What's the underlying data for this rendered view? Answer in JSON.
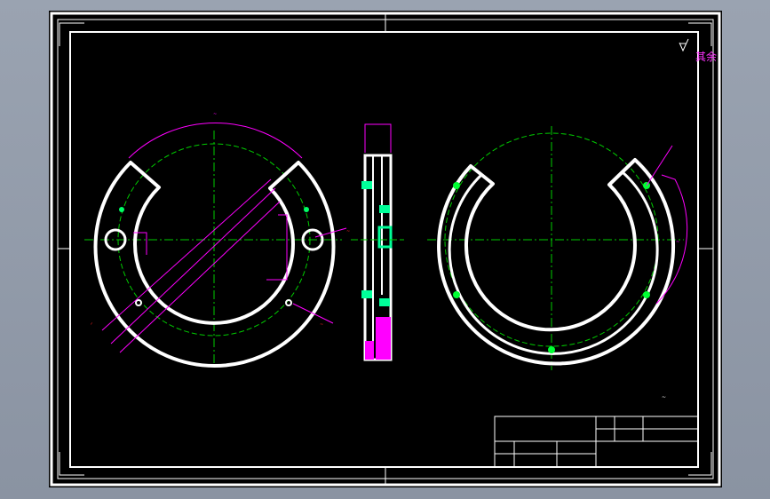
{
  "canvas": {
    "background": "#000000",
    "frame_color": "#ffffff",
    "centerline_color": "#00cc00",
    "dimension_color": "#ff00ff",
    "annotation_color": "#ff2222",
    "highlight_color": "#00ff66",
    "hatch_color": "#ff00ff"
  },
  "note": {
    "text": "其余",
    "surface_symbol": "roughness-symbol"
  },
  "views": [
    "front-view-left",
    "section-view-middle",
    "rear-view-right"
  ]
}
